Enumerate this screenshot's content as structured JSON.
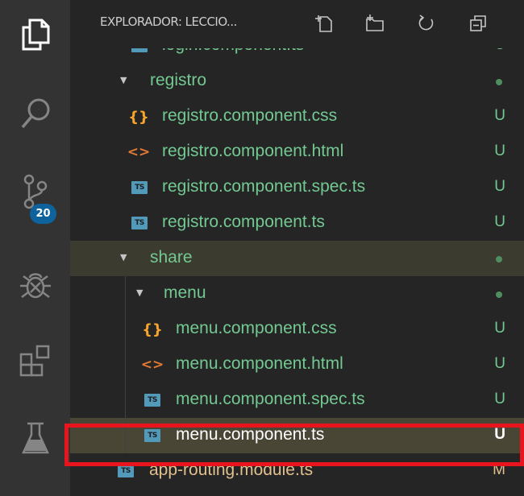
{
  "activity_bar": {
    "items": [
      {
        "icon": "files-icon"
      },
      {
        "icon": "search-icon"
      },
      {
        "icon": "source-control-icon",
        "badge": "20"
      },
      {
        "icon": "debug-icon"
      },
      {
        "icon": "extensions-icon"
      },
      {
        "icon": "testing-flask-icon"
      }
    ]
  },
  "explorer": {
    "title": "EXPLORADOR: LECCIO...",
    "actions": [
      {
        "icon": "new-file-icon"
      },
      {
        "icon": "new-folder-icon"
      },
      {
        "icon": "refresh-icon"
      },
      {
        "icon": "collapse-all-icon"
      }
    ],
    "rows": [
      {
        "name": "login.component.ts",
        "type": "ts",
        "status": "U"
      },
      {
        "name": "registro",
        "type": "folder",
        "status": "dot"
      },
      {
        "name": "registro.component.css",
        "type": "css",
        "status": "U"
      },
      {
        "name": "registro.component.html",
        "type": "html",
        "status": "U"
      },
      {
        "name": "registro.component.spec.ts",
        "type": "ts",
        "status": "U"
      },
      {
        "name": "registro.component.ts",
        "type": "ts",
        "status": "U"
      },
      {
        "name": "share",
        "type": "folder",
        "status": "dot"
      },
      {
        "name": "menu",
        "type": "folder",
        "status": "dot"
      },
      {
        "name": "menu.component.css",
        "type": "css",
        "status": "U"
      },
      {
        "name": "menu.component.html",
        "type": "html",
        "status": "U"
      },
      {
        "name": "menu.component.spec.ts",
        "type": "ts",
        "status": "U"
      },
      {
        "name": "menu.component.ts",
        "type": "ts",
        "status": "U"
      },
      {
        "name": "app-routing.module.ts",
        "type": "ts",
        "status": "M"
      }
    ],
    "ts_label": "TS",
    "css_glyph": "{}",
    "html_glyph": "<>"
  },
  "colors": {
    "untracked": "#73c991",
    "modified": "#e2c08d",
    "badge": "#0e639c",
    "highlight_box": "#e8141e"
  }
}
